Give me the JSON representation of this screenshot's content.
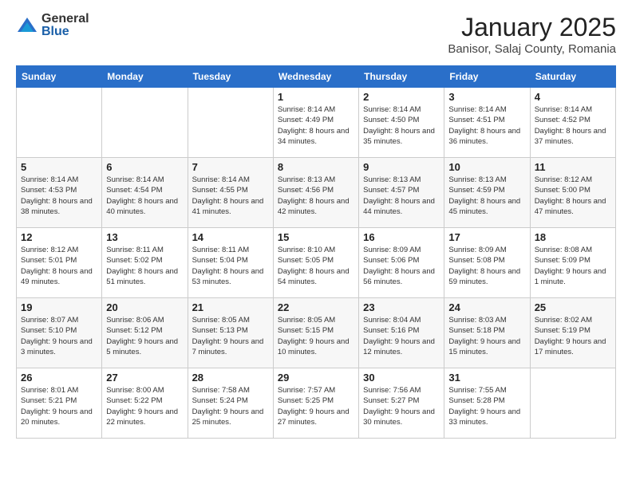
{
  "logo": {
    "general": "General",
    "blue": "Blue"
  },
  "title": "January 2025",
  "subtitle": "Banisor, Salaj County, Romania",
  "weekdays": [
    "Sunday",
    "Monday",
    "Tuesday",
    "Wednesday",
    "Thursday",
    "Friday",
    "Saturday"
  ],
  "weeks": [
    [
      {
        "day": "",
        "info": ""
      },
      {
        "day": "",
        "info": ""
      },
      {
        "day": "",
        "info": ""
      },
      {
        "day": "1",
        "info": "Sunrise: 8:14 AM\nSunset: 4:49 PM\nDaylight: 8 hours\nand 34 minutes."
      },
      {
        "day": "2",
        "info": "Sunrise: 8:14 AM\nSunset: 4:50 PM\nDaylight: 8 hours\nand 35 minutes."
      },
      {
        "day": "3",
        "info": "Sunrise: 8:14 AM\nSunset: 4:51 PM\nDaylight: 8 hours\nand 36 minutes."
      },
      {
        "day": "4",
        "info": "Sunrise: 8:14 AM\nSunset: 4:52 PM\nDaylight: 8 hours\nand 37 minutes."
      }
    ],
    [
      {
        "day": "5",
        "info": "Sunrise: 8:14 AM\nSunset: 4:53 PM\nDaylight: 8 hours\nand 38 minutes."
      },
      {
        "day": "6",
        "info": "Sunrise: 8:14 AM\nSunset: 4:54 PM\nDaylight: 8 hours\nand 40 minutes."
      },
      {
        "day": "7",
        "info": "Sunrise: 8:14 AM\nSunset: 4:55 PM\nDaylight: 8 hours\nand 41 minutes."
      },
      {
        "day": "8",
        "info": "Sunrise: 8:13 AM\nSunset: 4:56 PM\nDaylight: 8 hours\nand 42 minutes."
      },
      {
        "day": "9",
        "info": "Sunrise: 8:13 AM\nSunset: 4:57 PM\nDaylight: 8 hours\nand 44 minutes."
      },
      {
        "day": "10",
        "info": "Sunrise: 8:13 AM\nSunset: 4:59 PM\nDaylight: 8 hours\nand 45 minutes."
      },
      {
        "day": "11",
        "info": "Sunrise: 8:12 AM\nSunset: 5:00 PM\nDaylight: 8 hours\nand 47 minutes."
      }
    ],
    [
      {
        "day": "12",
        "info": "Sunrise: 8:12 AM\nSunset: 5:01 PM\nDaylight: 8 hours\nand 49 minutes."
      },
      {
        "day": "13",
        "info": "Sunrise: 8:11 AM\nSunset: 5:02 PM\nDaylight: 8 hours\nand 51 minutes."
      },
      {
        "day": "14",
        "info": "Sunrise: 8:11 AM\nSunset: 5:04 PM\nDaylight: 8 hours\nand 53 minutes."
      },
      {
        "day": "15",
        "info": "Sunrise: 8:10 AM\nSunset: 5:05 PM\nDaylight: 8 hours\nand 54 minutes."
      },
      {
        "day": "16",
        "info": "Sunrise: 8:09 AM\nSunset: 5:06 PM\nDaylight: 8 hours\nand 56 minutes."
      },
      {
        "day": "17",
        "info": "Sunrise: 8:09 AM\nSunset: 5:08 PM\nDaylight: 8 hours\nand 59 minutes."
      },
      {
        "day": "18",
        "info": "Sunrise: 8:08 AM\nSunset: 5:09 PM\nDaylight: 9 hours\nand 1 minute."
      }
    ],
    [
      {
        "day": "19",
        "info": "Sunrise: 8:07 AM\nSunset: 5:10 PM\nDaylight: 9 hours\nand 3 minutes."
      },
      {
        "day": "20",
        "info": "Sunrise: 8:06 AM\nSunset: 5:12 PM\nDaylight: 9 hours\nand 5 minutes."
      },
      {
        "day": "21",
        "info": "Sunrise: 8:05 AM\nSunset: 5:13 PM\nDaylight: 9 hours\nand 7 minutes."
      },
      {
        "day": "22",
        "info": "Sunrise: 8:05 AM\nSunset: 5:15 PM\nDaylight: 9 hours\nand 10 minutes."
      },
      {
        "day": "23",
        "info": "Sunrise: 8:04 AM\nSunset: 5:16 PM\nDaylight: 9 hours\nand 12 minutes."
      },
      {
        "day": "24",
        "info": "Sunrise: 8:03 AM\nSunset: 5:18 PM\nDaylight: 9 hours\nand 15 minutes."
      },
      {
        "day": "25",
        "info": "Sunrise: 8:02 AM\nSunset: 5:19 PM\nDaylight: 9 hours\nand 17 minutes."
      }
    ],
    [
      {
        "day": "26",
        "info": "Sunrise: 8:01 AM\nSunset: 5:21 PM\nDaylight: 9 hours\nand 20 minutes."
      },
      {
        "day": "27",
        "info": "Sunrise: 8:00 AM\nSunset: 5:22 PM\nDaylight: 9 hours\nand 22 minutes."
      },
      {
        "day": "28",
        "info": "Sunrise: 7:58 AM\nSunset: 5:24 PM\nDaylight: 9 hours\nand 25 minutes."
      },
      {
        "day": "29",
        "info": "Sunrise: 7:57 AM\nSunset: 5:25 PM\nDaylight: 9 hours\nand 27 minutes."
      },
      {
        "day": "30",
        "info": "Sunrise: 7:56 AM\nSunset: 5:27 PM\nDaylight: 9 hours\nand 30 minutes."
      },
      {
        "day": "31",
        "info": "Sunrise: 7:55 AM\nSunset: 5:28 PM\nDaylight: 9 hours\nand 33 minutes."
      },
      {
        "day": "",
        "info": ""
      }
    ]
  ]
}
